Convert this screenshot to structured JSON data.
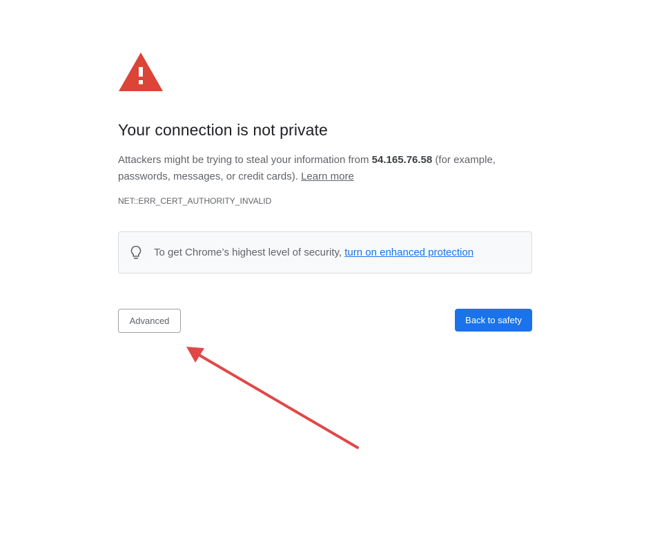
{
  "page": {
    "title": "Your connection is not private",
    "message": {
      "before_host": "Attackers might be trying to steal your information from ",
      "host": "54.165.76.58",
      "after_host": " (for example, passwords, messages, or credit cards). ",
      "learn_more_label": "Learn more"
    },
    "error_code": "NET::ERR_CERT_AUTHORITY_INVALID",
    "security_tip": {
      "icon": "lightbulb-icon",
      "text": "To get Chrome’s highest level of security, ",
      "link_label": "turn on enhanced protection"
    },
    "buttons": {
      "advanced_label": "Advanced",
      "back_to_safety_label": "Back to safety"
    },
    "icons": {
      "warning": "warning-triangle-icon",
      "annotation": "red-arrow-annotation"
    },
    "colors": {
      "warning_red": "#db4437",
      "primary_blue": "#1a73e8",
      "annotation_red": "#e04848"
    }
  }
}
